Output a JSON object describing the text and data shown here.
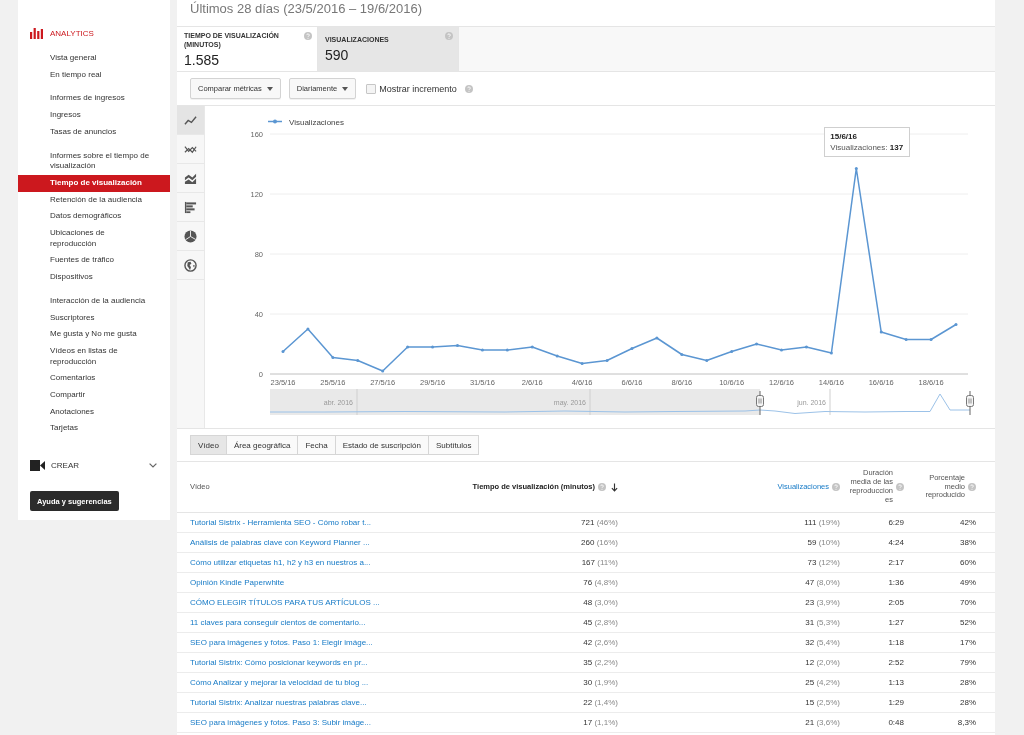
{
  "header": {
    "date_range": "Últimos 28 días (23/5/2016 – 19/6/2016)"
  },
  "sidebar": {
    "section": {
      "label": "ANALYTICS"
    },
    "groups": [
      {
        "items": [
          {
            "label": "Vista general",
            "selected": false
          },
          {
            "label": "En tiempo real",
            "selected": false
          }
        ]
      },
      {
        "items": [
          {
            "label": "Informes de ingresos",
            "selected": false
          },
          {
            "label": "Ingresos",
            "selected": false
          },
          {
            "label": "Tasas de anuncios",
            "selected": false
          }
        ]
      },
      {
        "items": [
          {
            "label": "Informes sobre el tiempo de visualización",
            "selected": false
          },
          {
            "label": "Tiempo de visualización",
            "selected": true
          },
          {
            "label": "Retención de la audiencia",
            "selected": false
          },
          {
            "label": "Datos demográficos",
            "selected": false
          },
          {
            "label": "Ubicaciones de reproducción",
            "selected": false
          },
          {
            "label": "Fuentes de tráfico",
            "selected": false
          },
          {
            "label": "Dispositivos",
            "selected": false
          }
        ]
      },
      {
        "items": [
          {
            "label": "Interacción de la audiencia",
            "selected": false
          },
          {
            "label": "Suscriptores",
            "selected": false
          },
          {
            "label": "Me gusta y No me gusta",
            "selected": false
          },
          {
            "label": "Vídeos en listas de reproducción",
            "selected": false
          },
          {
            "label": "Comentarios",
            "selected": false
          },
          {
            "label": "Compartir",
            "selected": false
          },
          {
            "label": "Anotaciones",
            "selected": false
          },
          {
            "label": "Tarjetas",
            "selected": false
          }
        ]
      }
    ],
    "create": {
      "label": "CREAR",
      "expanded": false
    },
    "help_button": "Ayuda y sugerencias"
  },
  "metrics": [
    {
      "label": "TIEMPO DE VISUALIZACIÓN (MINUTOS)",
      "value": "1.585",
      "selected": false
    },
    {
      "label": "VISUALIZACIONES",
      "value": "590",
      "selected": true
    }
  ],
  "controls": {
    "dropdowns": [
      "Comparar métricas",
      "Diariamente"
    ],
    "checkbox": {
      "label": "Mostrar incremento",
      "checked": false
    }
  },
  "chart_types": [
    {
      "kind": "line",
      "selected": true
    },
    {
      "kind": "multi_line",
      "selected": false
    },
    {
      "kind": "area",
      "selected": false
    },
    {
      "kind": "bar",
      "selected": false
    },
    {
      "kind": "pie",
      "selected": false
    },
    {
      "kind": "map",
      "selected": false
    }
  ],
  "chart": {
    "chart_data": {
      "type": "line",
      "categories": [
        "23/5/16",
        null,
        "25/5/16",
        null,
        "27/5/16",
        null,
        "29/5/16",
        null,
        "31/5/16",
        null,
        "2/6/16",
        null,
        "4/6/16",
        null,
        "6/6/16",
        null,
        "8/6/16",
        null,
        "10/6/16",
        null,
        "12/6/16",
        null,
        "14/6/16",
        null,
        "16/6/16",
        null,
        "18/6/16",
        null
      ],
      "series": [
        {
          "name": "Visualizaciones",
          "color": "#5b96d2",
          "values": [
            15,
            30,
            11,
            9,
            2,
            18,
            18,
            19,
            16,
            16,
            18,
            12,
            7,
            9,
            17,
            24,
            13,
            9,
            15,
            20,
            16,
            18,
            14,
            137,
            28,
            23,
            23,
            33
          ]
        }
      ],
      "ylim": [
        0,
        160
      ],
      "yticks": [
        0,
        40,
        80,
        120,
        160
      ],
      "grid": true,
      "annotations": [
        "**15/6/16**\nVisualizaciones: **137**"
      ]
    }
  },
  "navigator": {
    "labels": [
      "abr. 2016",
      "may. 2016",
      "jun. 2016"
    ]
  },
  "table_tabs": [
    {
      "label": "Vídeo",
      "selected": true
    },
    {
      "label": "Área geográfica",
      "selected": false
    },
    {
      "label": "Fecha",
      "selected": false
    },
    {
      "label": "Estado de suscripción",
      "selected": false
    },
    {
      "label": "Subtítulos",
      "selected": false
    }
  ],
  "table": {
    "columns": [
      {
        "label": "Vídeo",
        "sortable": false,
        "sorted": false,
        "help": false
      },
      {
        "label": "Tiempo de visualización (minutos)",
        "sortable": true,
        "sorted": true,
        "help": true
      },
      {
        "label": "Visualizaciones",
        "sortable": true,
        "sorted": false,
        "help": true
      },
      {
        "label": "Duración media de las reproducciones",
        "sortable": false,
        "sorted": false,
        "help": true
      },
      {
        "label": "Porcentaje medio reproducido",
        "sortable": false,
        "sorted": false,
        "help": true
      }
    ],
    "rows": [
      {
        "title": "Tutorial Sistrix - Herramienta SEO - Cómo robar t...",
        "watch_time": "721",
        "watch_time_share": "(46%)",
        "views": "111",
        "views_share": "(19%)",
        "avg_duration": "6:29",
        "avg_percentage": "42%"
      },
      {
        "title": "Análisis de palabras clave con Keyword Planner ...",
        "watch_time": "260",
        "watch_time_share": "(16%)",
        "views": "59",
        "views_share": "(10%)",
        "avg_duration": "4:24",
        "avg_percentage": "38%"
      },
      {
        "title": "Cómo utilizar etiquetas h1, h2 y h3 en nuestros a...",
        "watch_time": "167",
        "watch_time_share": "(11%)",
        "views": "73",
        "views_share": "(12%)",
        "avg_duration": "2:17",
        "avg_percentage": "60%"
      },
      {
        "title": "Opinión Kindle Paperwhite",
        "watch_time": "76",
        "watch_time_share": "(4,8%)",
        "views": "47",
        "views_share": "(8,0%)",
        "avg_duration": "1:36",
        "avg_percentage": "49%"
      },
      {
        "title": "CÓMO ELEGIR TÍTULOS PARA TUS ARTÍCULOS ...",
        "watch_time": "48",
        "watch_time_share": "(3,0%)",
        "views": "23",
        "views_share": "(3,9%)",
        "avg_duration": "2:05",
        "avg_percentage": "70%"
      },
      {
        "title": "11 claves para conseguir cientos de comentario...",
        "watch_time": "45",
        "watch_time_share": "(2,8%)",
        "views": "31",
        "views_share": "(5,3%)",
        "avg_duration": "1:27",
        "avg_percentage": "52%"
      },
      {
        "title": "SEO para imágenes y fotos. Paso 1: Elegir imáge...",
        "watch_time": "42",
        "watch_time_share": "(2,6%)",
        "views": "32",
        "views_share": "(5,4%)",
        "avg_duration": "1:18",
        "avg_percentage": "17%"
      },
      {
        "title": "Tutorial Sistrix: Cómo posicionar keywords en pr...",
        "watch_time": "35",
        "watch_time_share": "(2,2%)",
        "views": "12",
        "views_share": "(2,0%)",
        "avg_duration": "2:52",
        "avg_percentage": "79%"
      },
      {
        "title": "Cómo Analizar y mejorar la velocidad de tu blog ...",
        "watch_time": "30",
        "watch_time_share": "(1,9%)",
        "views": "25",
        "views_share": "(4,2%)",
        "avg_duration": "1:13",
        "avg_percentage": "28%"
      },
      {
        "title": "Tutorial Sistrix: Analizar nuestras palabras clave...",
        "watch_time": "22",
        "watch_time_share": "(1,4%)",
        "views": "15",
        "views_share": "(2,5%)",
        "avg_duration": "1:29",
        "avg_percentage": "28%"
      },
      {
        "title": "SEO para imágenes y fotos. Paso 3: Subir imáge...",
        "watch_time": "17",
        "watch_time_share": "(1,1%)",
        "views": "21",
        "views_share": "(3,6%)",
        "avg_duration": "0:48",
        "avg_percentage": "8,3%"
      }
    ]
  }
}
